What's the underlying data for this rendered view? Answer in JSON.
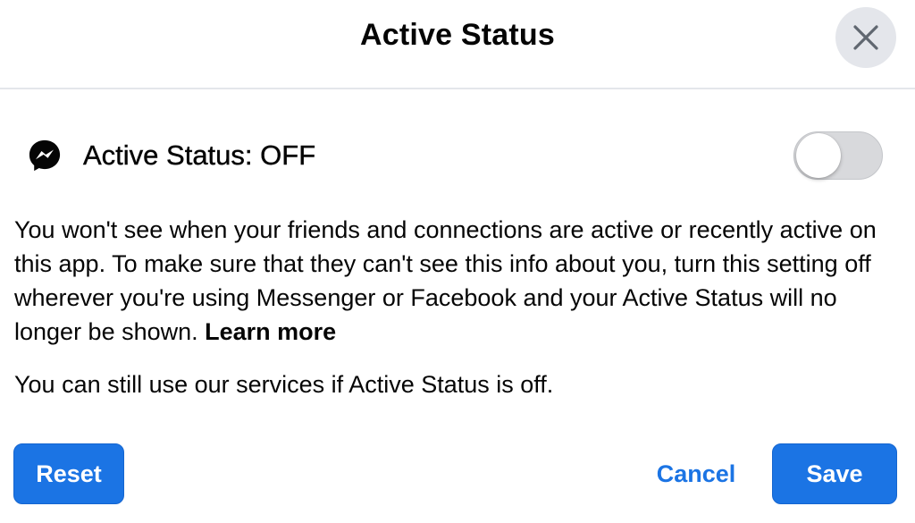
{
  "dialog": {
    "title": "Active Status",
    "close_icon": "close-icon"
  },
  "status": {
    "icon": "messenger-icon",
    "label": "Active Status: OFF",
    "toggle_on": false
  },
  "description": {
    "text": "You won't see when your friends and connections are active or recently active on this app. To make sure that they can't see this info about you, turn this setting off wherever you're using Messenger or Facebook and your Active Status will no longer be shown. ",
    "link_label": "Learn more"
  },
  "note": "You can still use our services if Active Status is off.",
  "buttons": {
    "reset": "Reset",
    "cancel": "Cancel",
    "save": "Save"
  },
  "colors": {
    "accent": "#1b74e4",
    "toggle_off": "#d8d9dc",
    "close_bg": "#e4e6eb"
  }
}
